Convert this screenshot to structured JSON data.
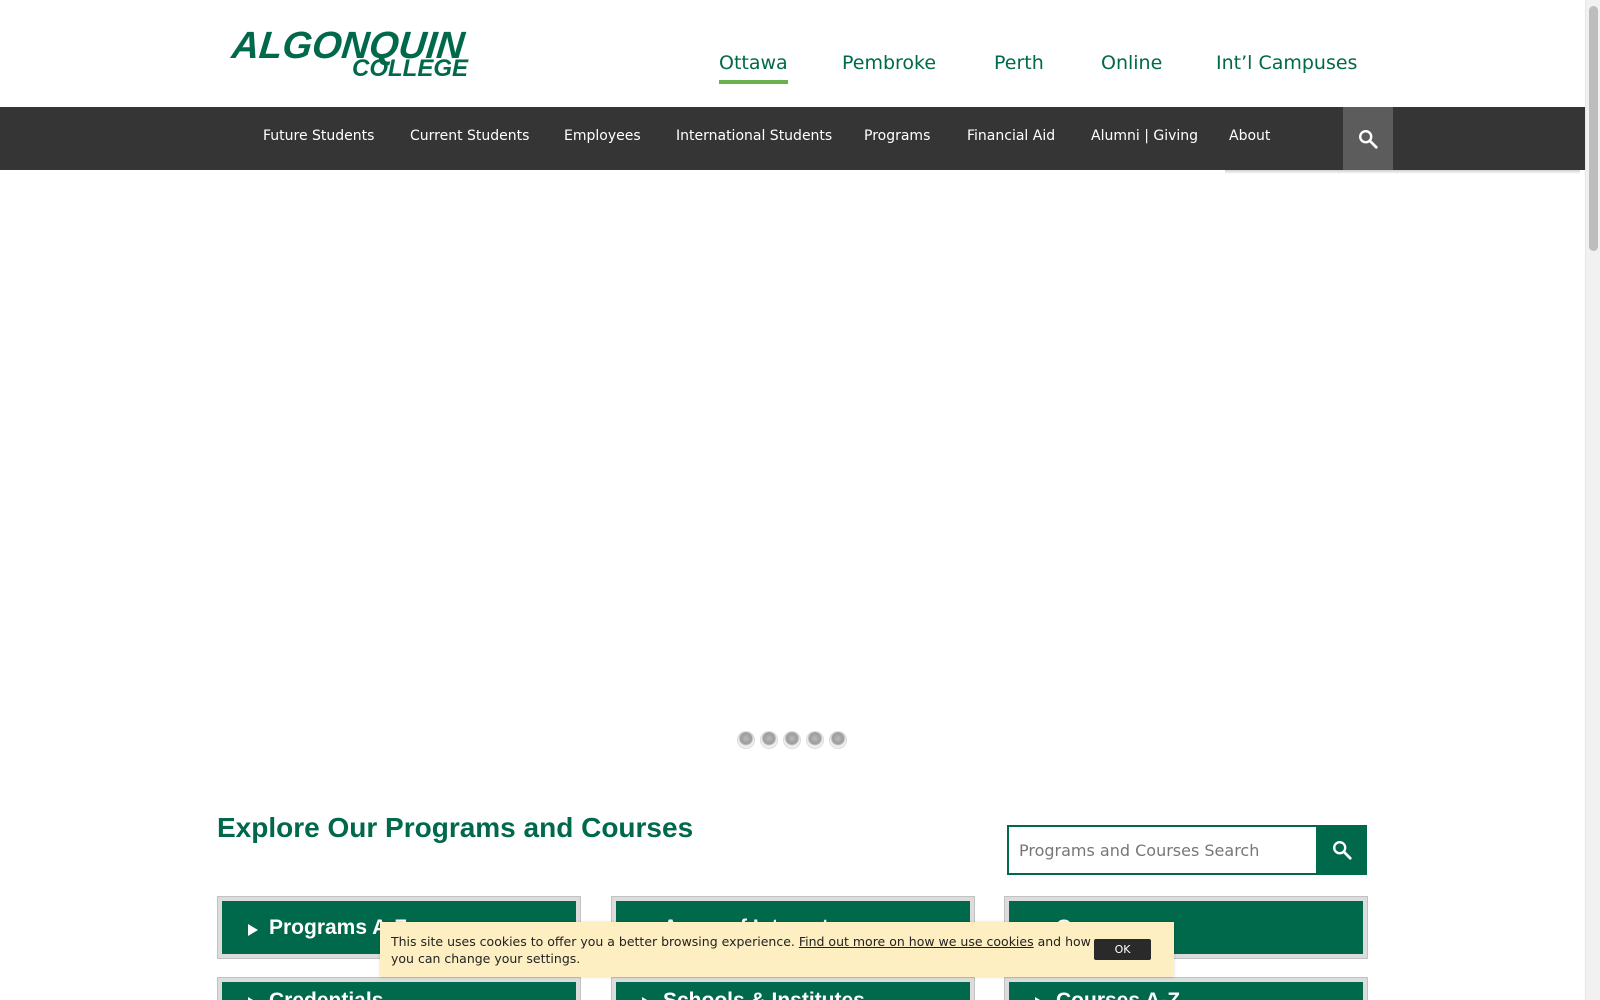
{
  "logo": {
    "line1": "ALGONQUIN",
    "line2": "COLLEGE"
  },
  "campus_nav": [
    {
      "label": "Ottawa",
      "active": true
    },
    {
      "label": "Pembroke",
      "active": false
    },
    {
      "label": "Perth",
      "active": false
    },
    {
      "label": "Online",
      "active": false
    },
    {
      "label": "Int’l Campuses",
      "active": false
    }
  ],
  "main_nav": [
    {
      "label": "Future Students"
    },
    {
      "label": "Current Students"
    },
    {
      "label": "Employees"
    },
    {
      "label": "International Students"
    },
    {
      "label": "Programs"
    },
    {
      "label": "Financial Aid"
    },
    {
      "label": "Alumni | Giving"
    },
    {
      "label": "About"
    }
  ],
  "carousel": {
    "slide_count": 5
  },
  "explore": {
    "title": "Explore Our Programs and Courses",
    "search_placeholder": "Programs and Courses Search",
    "tiles": [
      {
        "label": "Programs A-Z"
      },
      {
        "label": "Areas of Interest"
      },
      {
        "label": "Campus"
      },
      {
        "label": "Credentials"
      },
      {
        "label": "Schools & Institutes"
      },
      {
        "label": "Courses A-Z"
      }
    ]
  },
  "cookie_banner": {
    "text_before": "This site uses cookies to offer you a better browsing experience. ",
    "link_text": "Find out more on how we use cookies",
    "text_after": " and how you can change your settings.",
    "ok_label": "OK"
  },
  "colors": {
    "brand_green": "#00694b",
    "active_underline": "#6ab04c",
    "nav_bar": "#353535",
    "cookie_bg": "#fdefc2"
  },
  "icons": {
    "nav_search": "search-icon",
    "program_search": "search-icon",
    "tile_arrow": "triangle-right-icon"
  }
}
